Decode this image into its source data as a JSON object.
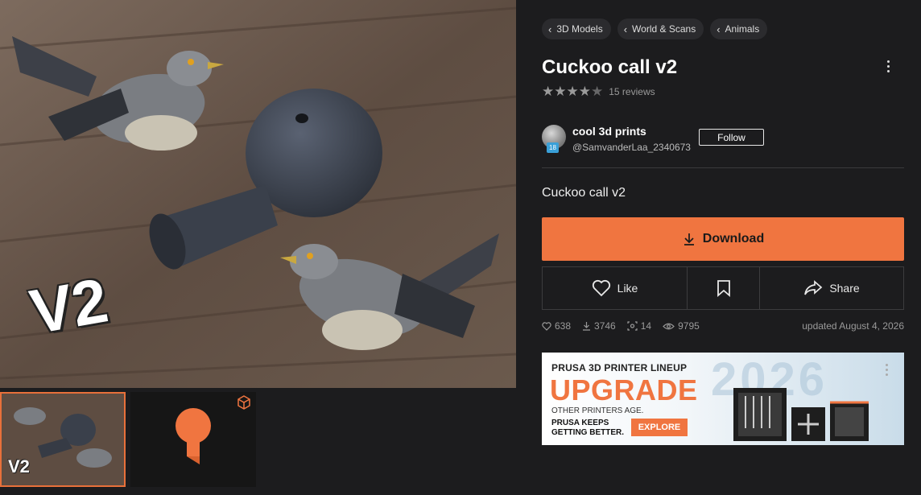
{
  "breadcrumbs": [
    {
      "label": "3D Models"
    },
    {
      "label": "World & Scans"
    },
    {
      "label": "Animals"
    }
  ],
  "model": {
    "title": "Cuckoo call v2",
    "rating": 4.5,
    "reviews": "15 reviews",
    "subtitle": "Cuckoo call v2",
    "hero_overlay": "V2",
    "thumb_overlay": "V2"
  },
  "author": {
    "name": "cool 3d prints",
    "handle": "@SamvanderLaa_2340673",
    "level": "18",
    "follow_label": "Follow"
  },
  "actions": {
    "download": "Download",
    "like": "Like",
    "share": "Share",
    "save_icon": "bookmark-icon"
  },
  "stats": {
    "likes": "638",
    "downloads": "3746",
    "makes": "14",
    "views": "9795",
    "updated": "updated August 4, 2026"
  },
  "ad": {
    "line1": "PRUSA 3D PRINTER LINEUP",
    "headline": "UPGRADE",
    "line2": "OTHER PRINTERS AGE.",
    "line3": "PRUSA KEEPS GETTING BETTER.",
    "cta": "EXPLORE",
    "year": "2026"
  },
  "colors": {
    "accent": "#f07540",
    "background": "#1c1c1e",
    "chip": "#2b2b2e"
  }
}
